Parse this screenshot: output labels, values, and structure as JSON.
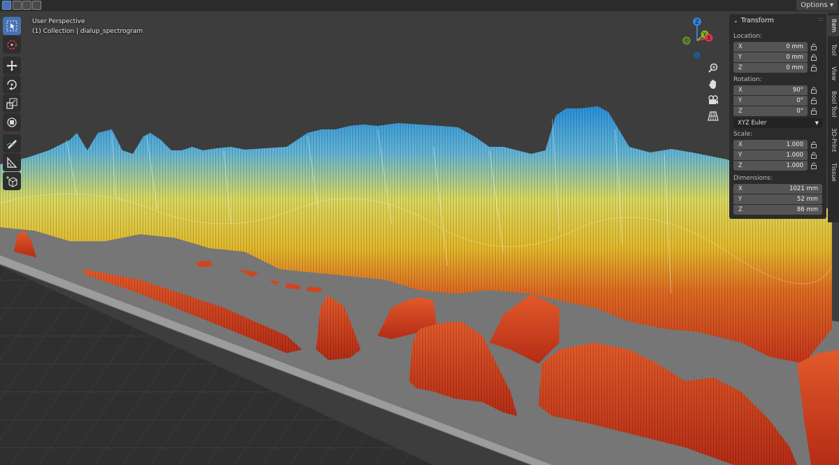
{
  "header": {
    "view_name": "User Perspective",
    "collection_line": "(1) Collection | dialup_spectrogram"
  },
  "topbar": {
    "options_label": "Options",
    "dropdown_icon": "chevron-down-icon"
  },
  "toolbar": {
    "tools": [
      "select-box-icon",
      "cursor-icon",
      "move-icon",
      "rotate-icon",
      "scale-icon",
      "transform-icon",
      "annotate-icon",
      "measure-icon",
      "add-cube-icon"
    ],
    "active_tool": "select-box-icon"
  },
  "gizmo": {
    "z_label": "Z",
    "y_label": "Y",
    "x_label": "X",
    "colors": {
      "x": "#e2334b",
      "y": "#86b12a",
      "z": "#2f83d9"
    }
  },
  "side_tabs": [
    "Item",
    "Tool",
    "View",
    "Bool Tool",
    "3D-Print",
    "Tissue"
  ],
  "active_side_tab": "Item",
  "transform": {
    "title": "Transform",
    "location_label": "Location:",
    "location": [
      {
        "axis": "X",
        "value": "0 mm"
      },
      {
        "axis": "Y",
        "value": "0 mm"
      },
      {
        "axis": "Z",
        "value": "0 mm"
      }
    ],
    "rotation_label": "Rotation:",
    "rotation": [
      {
        "axis": "X",
        "value": "90°"
      },
      {
        "axis": "Y",
        "value": "0°"
      },
      {
        "axis": "Z",
        "value": "0°"
      }
    ],
    "rotation_mode": "XYZ Euler",
    "scale_label": "Scale:",
    "scale": [
      {
        "axis": "X",
        "value": "1.000"
      },
      {
        "axis": "Y",
        "value": "1.000"
      },
      {
        "axis": "Z",
        "value": "1.000"
      }
    ],
    "dimensions_label": "Dimensions:",
    "dimensions": [
      {
        "axis": "X",
        "value": "1021 mm"
      },
      {
        "axis": "Y",
        "value": "52 mm"
      },
      {
        "axis": "Z",
        "value": "86 mm"
      }
    ]
  },
  "colors": {
    "accent": "#4772b3",
    "viewport_bg": "#3d3d3d",
    "panel_bg": "#2b2b2b",
    "spectro_low": "#d43a20",
    "spectro_mid": "#e7d23a",
    "spectro_high": "#2f8ed6"
  }
}
